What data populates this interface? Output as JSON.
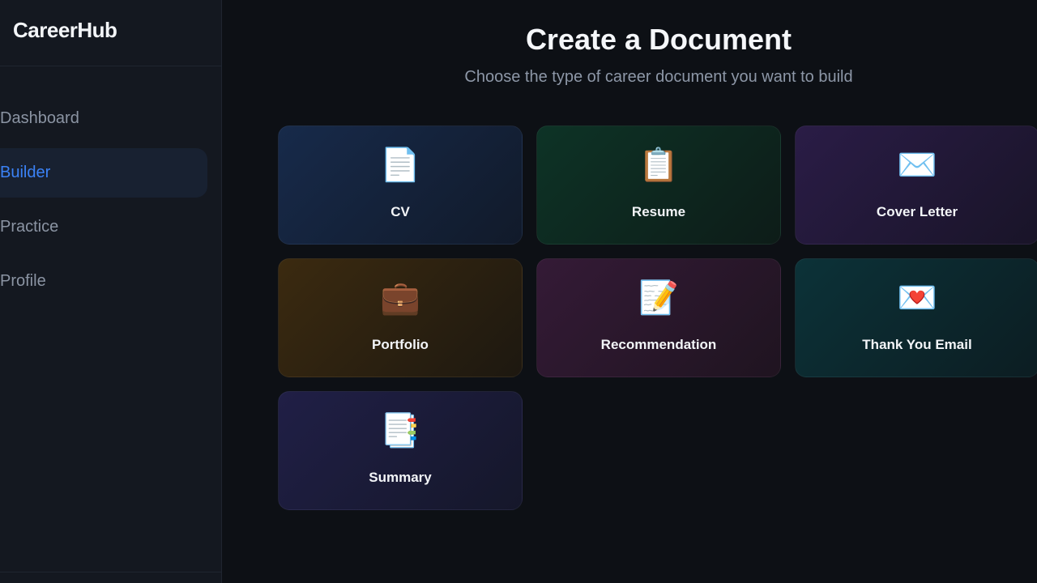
{
  "app": {
    "brand": "CareerHub"
  },
  "sidebar": {
    "items": [
      {
        "label": "Dashboard",
        "active": false
      },
      {
        "label": "Builder",
        "active": true
      },
      {
        "label": "Practice",
        "active": false
      },
      {
        "label": "Profile",
        "active": false
      }
    ]
  },
  "main": {
    "title": "Create a Document",
    "subtitle": "Choose the type of career document you want to build",
    "cards": [
      {
        "label": "CV",
        "icon": "📄",
        "icon_name": "document-icon"
      },
      {
        "label": "Resume",
        "icon": "📋",
        "icon_name": "clipboard-icon"
      },
      {
        "label": "Cover Letter",
        "icon": "✉️",
        "icon_name": "envelope-icon"
      },
      {
        "label": "Portfolio",
        "icon": "💼",
        "icon_name": "briefcase-icon"
      },
      {
        "label": "Recommendation",
        "icon": "📝",
        "icon_name": "memo-icon"
      },
      {
        "label": "Thank You Email",
        "icon": "💌",
        "icon_name": "love-letter-icon"
      },
      {
        "label": "Summary",
        "icon": "📑",
        "icon_name": "bookmark-tabs-icon"
      }
    ]
  }
}
